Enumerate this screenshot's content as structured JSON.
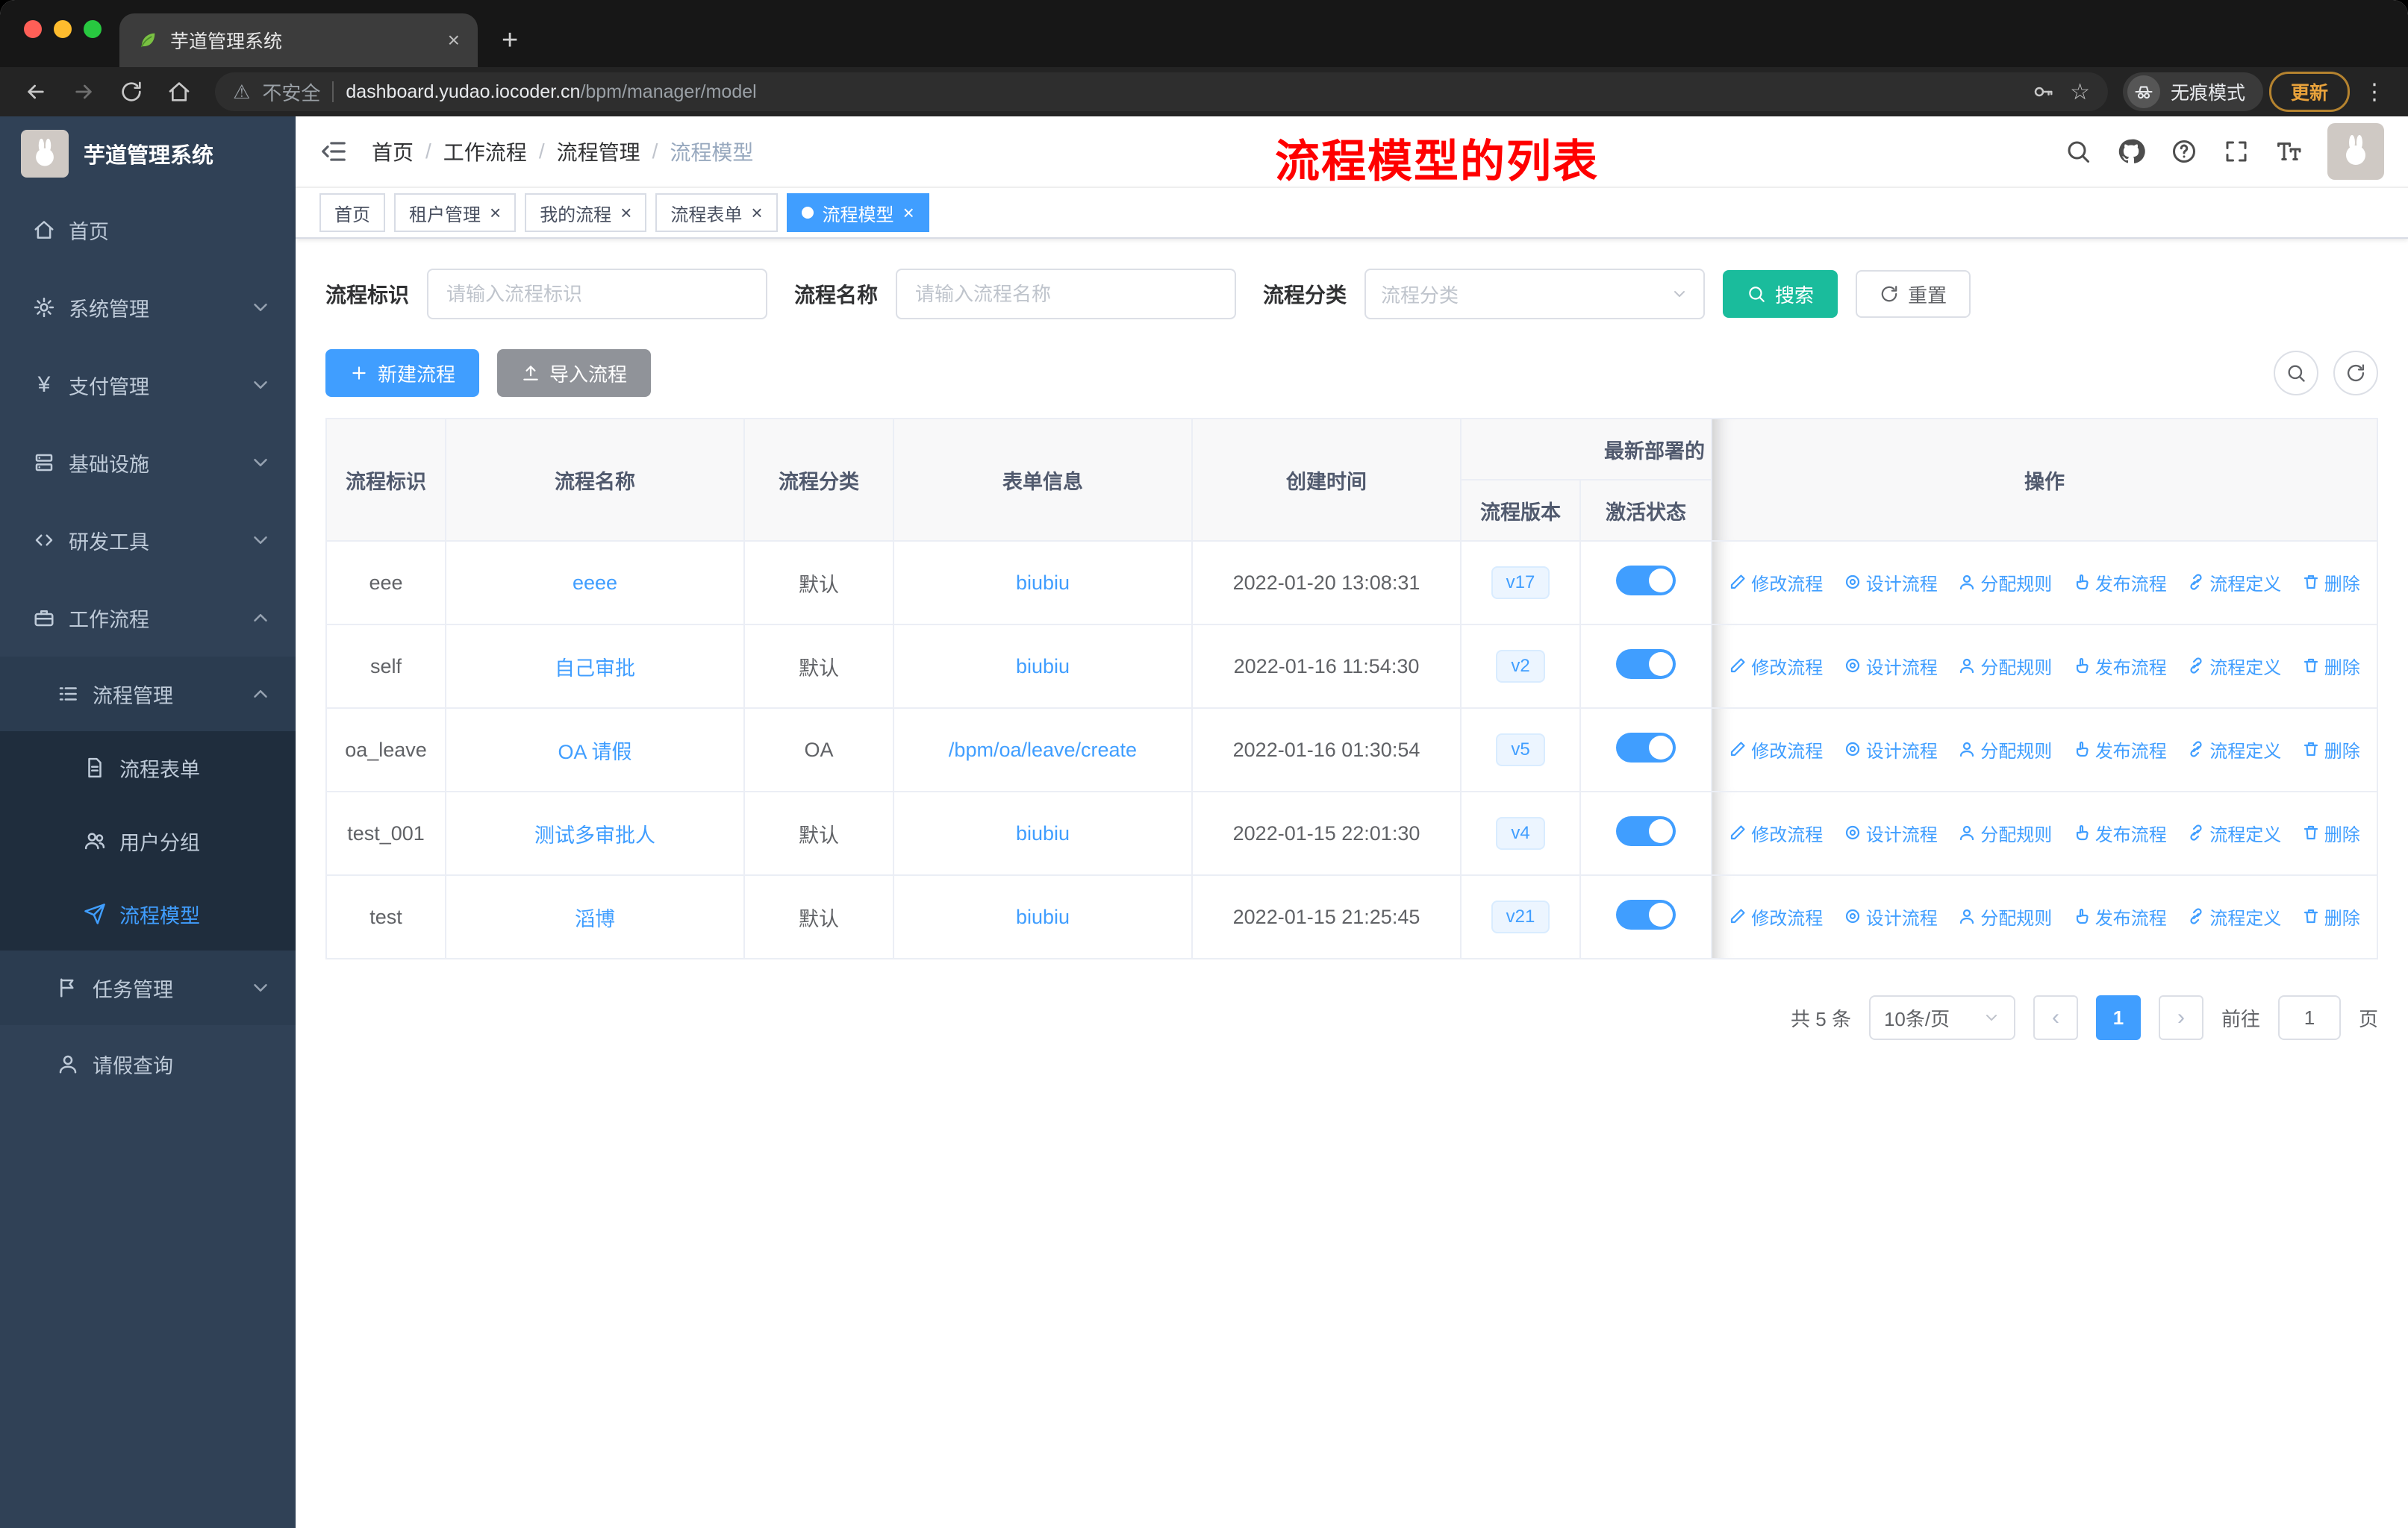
{
  "browser": {
    "tab_title": "芋道管理系统",
    "security_label": "不安全",
    "url_host": "dashboard.yudao.iocoder.cn",
    "url_path": "/bpm/manager/model",
    "incognito_label": "无痕模式",
    "update_label": "更新"
  },
  "icons": {
    "warning": "⚠",
    "star": "☆",
    "kebab": "⋮",
    "new_tab": "+",
    "close": "×",
    "prev": "‹",
    "next": "›"
  },
  "sidebar": {
    "logo_title": "芋道管理系统",
    "items": {
      "home": "首页",
      "system": "系统管理",
      "payment": "支付管理",
      "infra": "基础设施",
      "dev": "研发工具",
      "workflow": "工作流程",
      "process_mgmt": "流程管理",
      "process_form": "流程表单",
      "user_group": "用户分组",
      "process_model": "流程模型",
      "task_mgmt": "任务管理",
      "leave_query": "请假查询"
    }
  },
  "navbar": {
    "breadcrumb": [
      "首页",
      "工作流程",
      "流程管理",
      "流程模型"
    ],
    "annotation": "流程模型的列表"
  },
  "tags": [
    "首页",
    "租户管理",
    "我的流程",
    "流程表单",
    "流程模型"
  ],
  "filters": {
    "id_label": "流程标识",
    "id_placeholder": "请输入流程标识",
    "name_label": "流程名称",
    "name_placeholder": "请输入流程名称",
    "category_label": "流程分类",
    "category_placeholder": "流程分类",
    "search_label": "搜索",
    "reset_label": "重置"
  },
  "toolbar": {
    "create_label": "新建流程",
    "import_label": "导入流程"
  },
  "table": {
    "headers": {
      "id": "流程标识",
      "name": "流程名称",
      "category": "流程分类",
      "form": "表单信息",
      "created": "创建时间",
      "deploy_group": "最新部署的",
      "version": "流程版本",
      "status": "激活状态",
      "actions": "操作"
    },
    "ops": [
      "修改流程",
      "设计流程",
      "分配规则",
      "发布流程",
      "流程定义",
      "删除"
    ],
    "rows": [
      {
        "id": "eee",
        "name": "eeee",
        "category": "默认",
        "form": "biubiu",
        "created": "2022-01-20 13:08:31",
        "version": "v17",
        "active": true
      },
      {
        "id": "self",
        "name": "自己审批",
        "category": "默认",
        "form": "biubiu",
        "created": "2022-01-16 11:54:30",
        "version": "v2",
        "active": true
      },
      {
        "id": "oa_leave",
        "name": "OA 请假",
        "category": "OA",
        "form": "/bpm/oa/leave/create",
        "created": "2022-01-16 01:30:54",
        "version": "v5",
        "active": true
      },
      {
        "id": "test_001",
        "name": "测试多审批人",
        "category": "默认",
        "form": "biubiu",
        "created": "2022-01-15 22:01:30",
        "version": "v4",
        "active": true
      },
      {
        "id": "test",
        "name": "滔博",
        "category": "默认",
        "form": "biubiu",
        "created": "2022-01-15 21:25:45",
        "version": "v21",
        "active": true
      }
    ]
  },
  "pagination": {
    "total": "共 5 条",
    "page_size": "10条/页",
    "page": "1",
    "goto_label": "前往",
    "goto_value": "1",
    "page_unit": "页"
  },
  "colors": {
    "accent": "#409EFF",
    "sidebar_bg": "#304156",
    "submenu_bg": "#1F2D3D",
    "search_button": "#1ABC9C",
    "info_button": "#909399",
    "annotation_red": "#FF0000",
    "toggle_on": "#409EFF",
    "update_chip": "#E9A23B",
    "traffic_red": "#FF5F57",
    "traffic_yellow": "#FEBC2E",
    "traffic_green": "#28C840"
  }
}
